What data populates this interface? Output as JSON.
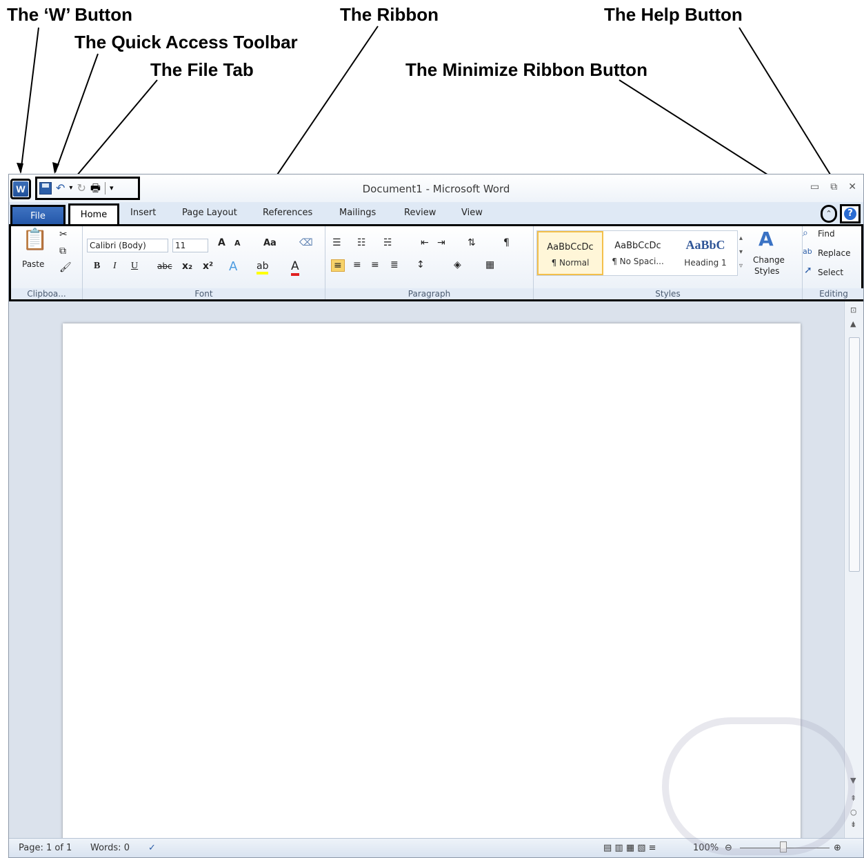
{
  "annotations": {
    "w_button": "The ‘W’ Button",
    "quick_access": "The Quick Access Toolbar",
    "file_tab": "The File Tab",
    "ribbon": "The Ribbon",
    "minimize": "The Minimize Ribbon Button",
    "help": "The Help Button"
  },
  "titlebar": {
    "app_icon_letter": "W",
    "title": "Document1 - Microsoft Word"
  },
  "tabs": {
    "file": "File",
    "home": "Home",
    "insert": "Insert",
    "page_layout": "Page Layout",
    "references": "References",
    "mailings": "Mailings",
    "review": "Review",
    "view": "View"
  },
  "ribbon": {
    "clipboard": {
      "label": "Clipboa...",
      "paste": "Paste"
    },
    "font": {
      "label": "Font",
      "font_name": "Calibri (Body)",
      "font_size": "11",
      "case_label": "Aa"
    },
    "paragraph": {
      "label": "Paragraph"
    },
    "styles": {
      "label": "Styles",
      "items": [
        {
          "sample": "AaBbCcDc",
          "name": "¶ Normal"
        },
        {
          "sample": "AaBbCcDc",
          "name": "¶ No Spaci..."
        },
        {
          "sample": "AaBbC",
          "name": "Heading 1"
        }
      ],
      "change_styles_1": "Change",
      "change_styles_2": "Styles"
    },
    "editing": {
      "label": "Editing",
      "find": "Find",
      "replace": "Replace",
      "select": "Select"
    }
  },
  "statusbar": {
    "page": "Page: 1 of 1",
    "words": "Words: 0",
    "zoom": "100%"
  },
  "colors": {
    "accent": "#2457a8",
    "annotation": "#000000"
  }
}
